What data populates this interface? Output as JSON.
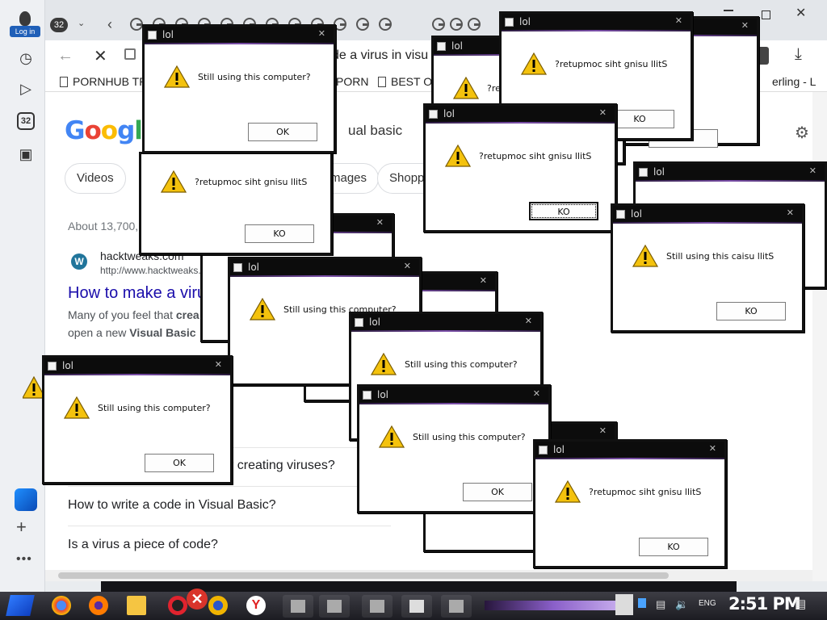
{
  "sidebar": {
    "login_label": "Log in",
    "tabs_badge": "32"
  },
  "tabbar": {
    "tab_count": "32"
  },
  "navbar": {
    "url_text": "de a virus in visu"
  },
  "bookmarks": [
    {
      "label": "PORNHUB TRA"
    },
    {
      "label": "PORN"
    },
    {
      "label": "BEST O"
    },
    {
      "label": "erling - L"
    }
  ],
  "google": {
    "logo": [
      "G",
      "o",
      "o",
      "g",
      "l",
      "e"
    ],
    "search_text": "ual basic",
    "chips": [
      "Videos",
      "mages",
      "Shoppi"
    ],
    "result_count": "About 13,700,",
    "site_name": "hacktweaks.com",
    "site_url": "http://www.hacktweaks.",
    "result_title": "How to make a viru",
    "snippet_1_prefix": "Many of you feel that ",
    "snippet_1_bold": "crea",
    "snippet_2_prefix": "open a new ",
    "snippet_2_bold": "Visual Basic",
    "paa": [
      "r creating viruses?",
      "How to write a code in Visual Basic?",
      "Is a virus a piece of code?"
    ]
  },
  "popup": {
    "title": "lol",
    "messages": {
      "normal": "Still using this computer?",
      "reversed": "?retupmoc siht gnisu llitS",
      "mixed": "Still using this caisu llitS",
      "clipped": "Still using this co"
    },
    "ok": "OK",
    "ko": "KO"
  },
  "taskbar": {
    "language": "ENG",
    "clock": "2:51 PM"
  },
  "colors": {
    "link": "#1a0dab",
    "titlebar": "#0c0c0c",
    "accent_purple": "#7a4ea8"
  }
}
